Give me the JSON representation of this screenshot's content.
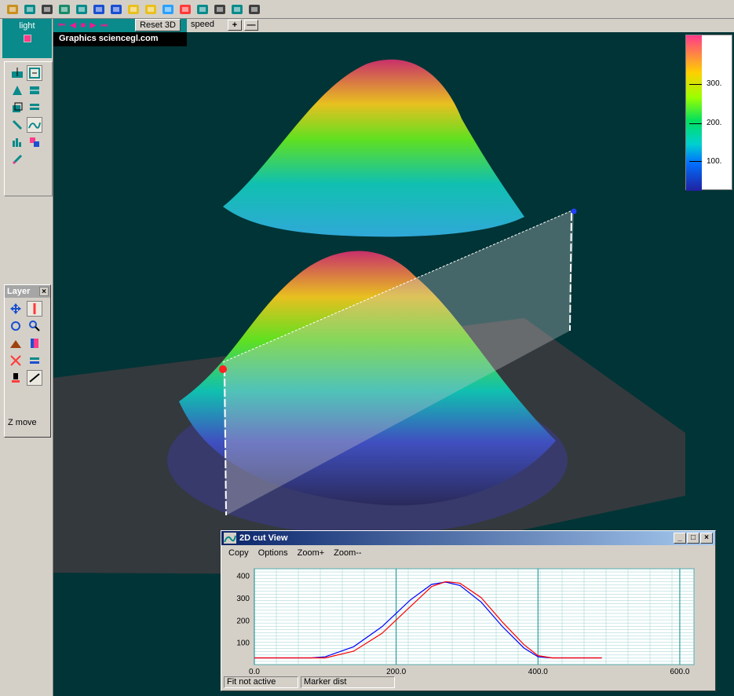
{
  "toolbar": {
    "icons": [
      "open-icon",
      "save-icon",
      "print-icon",
      "globe-icon",
      "camera-icon",
      "zoom-in-icon",
      "zoom-out-icon",
      "light-cone-icon",
      "light-beam-icon",
      "sparkle-icon",
      "color-palette-icon",
      "color-bars-icon",
      "axes-icon",
      "cut-view-icon",
      "tornado-icon"
    ]
  },
  "left_panel": {
    "light_label": "light",
    "light_color": "#ff3a8a"
  },
  "anim_bar": {
    "reset_label": "Reset 3D",
    "speed_label": "speed",
    "plus_label": "+",
    "minus_label": "—"
  },
  "watermark": "Graphics sciencegl.com",
  "colorbar": {
    "labels": [
      "300.",
      "200.",
      "100."
    ]
  },
  "layer_panel": {
    "title": "Layer",
    "close": "×",
    "mode_label": "Z move"
  },
  "cut_window": {
    "title": "2D cut View",
    "menu": [
      "Copy",
      "Options",
      "Zoom+",
      "Zoom--"
    ],
    "status_left": "Fit not active",
    "status_right": "Marker dist"
  },
  "chart_data": {
    "type": "line",
    "x_ticks": [
      "0.0",
      "200.0",
      "400.0",
      "600.0"
    ],
    "y_ticks": [
      "400",
      "300",
      "200",
      "100"
    ],
    "xlim": [
      0,
      620
    ],
    "ylim": [
      0,
      430
    ],
    "series": [
      {
        "color": "#0000ff",
        "x": [
          0,
          80,
          100,
          140,
          180,
          220,
          250,
          270,
          290,
          320,
          350,
          380,
          400,
          420,
          450,
          470,
          490
        ],
        "y": [
          30,
          30,
          35,
          80,
          170,
          290,
          360,
          370,
          355,
          280,
          170,
          75,
          35,
          30,
          30,
          30,
          30
        ]
      },
      {
        "color": "#ff0000",
        "x": [
          0,
          80,
          100,
          140,
          180,
          220,
          250,
          270,
          290,
          320,
          350,
          380,
          400,
          420,
          450,
          470,
          490
        ],
        "y": [
          30,
          30,
          30,
          60,
          140,
          260,
          350,
          372,
          365,
          300,
          190,
          90,
          40,
          30,
          30,
          30,
          30
        ]
      }
    ]
  },
  "colors": {
    "viewport_bg": "#003436",
    "accent_teal": "#0a8a8a"
  }
}
